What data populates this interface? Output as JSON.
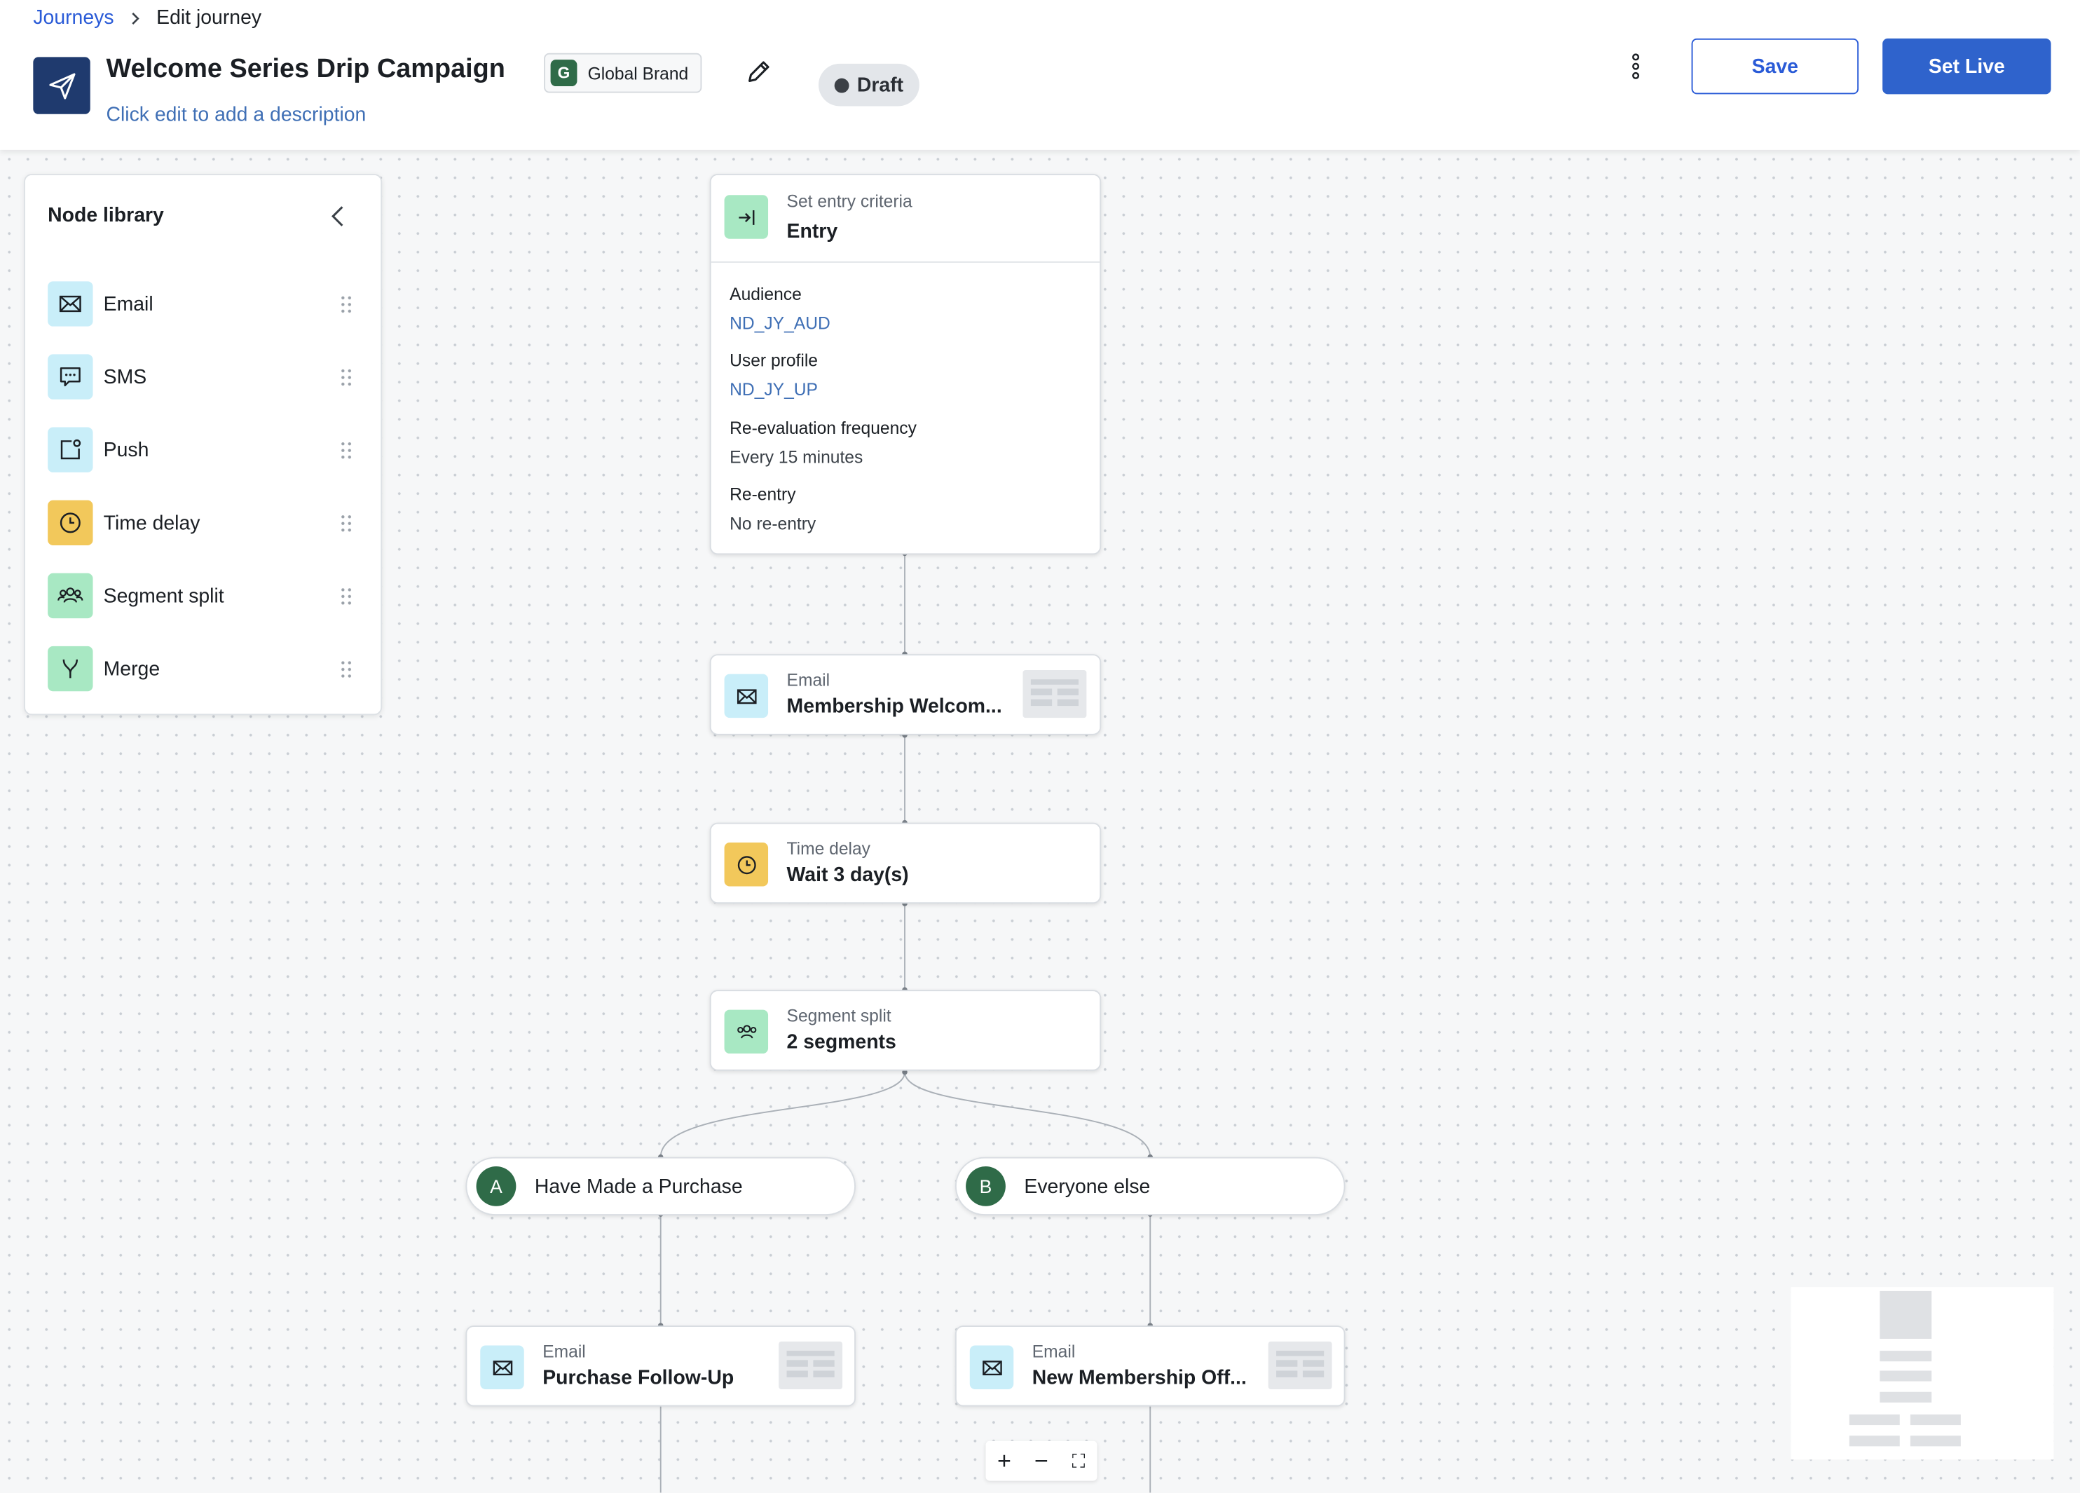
{
  "breadcrumb": {
    "parent": "Journeys",
    "separator": "›",
    "current": "Edit journey"
  },
  "journey": {
    "title": "Welcome Series Drip Campaign",
    "description_hint": "Click edit to add a description",
    "brand": {
      "initial": "G",
      "name": "Global Brand"
    },
    "status": "Draft"
  },
  "actions": {
    "save": "Save",
    "set_live": "Set Live",
    "more_icon": "vertical-dots-icon",
    "edit_icon": "pencil-icon"
  },
  "library": {
    "title": "Node library",
    "collapse_icon": "chevron-left-icon",
    "items": [
      {
        "label": "Email",
        "icon": "envelope-icon"
      },
      {
        "label": "SMS",
        "icon": "chat-icon"
      },
      {
        "label": "Push",
        "icon": "push-notification-icon"
      },
      {
        "label": "Time delay",
        "icon": "clock-icon"
      },
      {
        "label": "Segment split",
        "icon": "people-icon"
      },
      {
        "label": "Merge",
        "icon": "merge-icon"
      }
    ]
  },
  "flow": {
    "entry": {
      "kicker": "Set entry criteria",
      "name": "Entry",
      "fields": [
        {
          "label": "Audience",
          "value": "ND_JY_AUD"
        },
        {
          "label": "User profile",
          "value": "ND_JY_UP"
        },
        {
          "label": "Re-evaluation frequency",
          "value": "Every 15 minutes"
        },
        {
          "label": "Re-entry",
          "value": "No re-entry"
        }
      ]
    },
    "email1": {
      "kicker": "Email",
      "name": "Membership Welcom..."
    },
    "delay": {
      "kicker": "Time delay",
      "name": "Wait 3 day(s)"
    },
    "split": {
      "kicker": "Segment split",
      "name": "2 segments"
    },
    "segments": [
      {
        "badge": "A",
        "label": "Have Made a Purchase"
      },
      {
        "badge": "B",
        "label": "Everyone else"
      }
    ],
    "email_a": {
      "kicker": "Email",
      "name": "Purchase Follow-Up"
    },
    "email_b": {
      "kicker": "Email",
      "name": "New Membership Off..."
    }
  },
  "zoom_controls": {
    "zoom_in": "+",
    "zoom_out": "−",
    "fit": "⛶"
  },
  "colors": {
    "accent": "#2f63cc",
    "email_bg": "#c9eef9",
    "delay_bg": "#f2c85b",
    "split_bg": "#a8e8c3",
    "segment_badge": "#2f6b48",
    "nav_icon_bg": "#1f3a6e"
  }
}
